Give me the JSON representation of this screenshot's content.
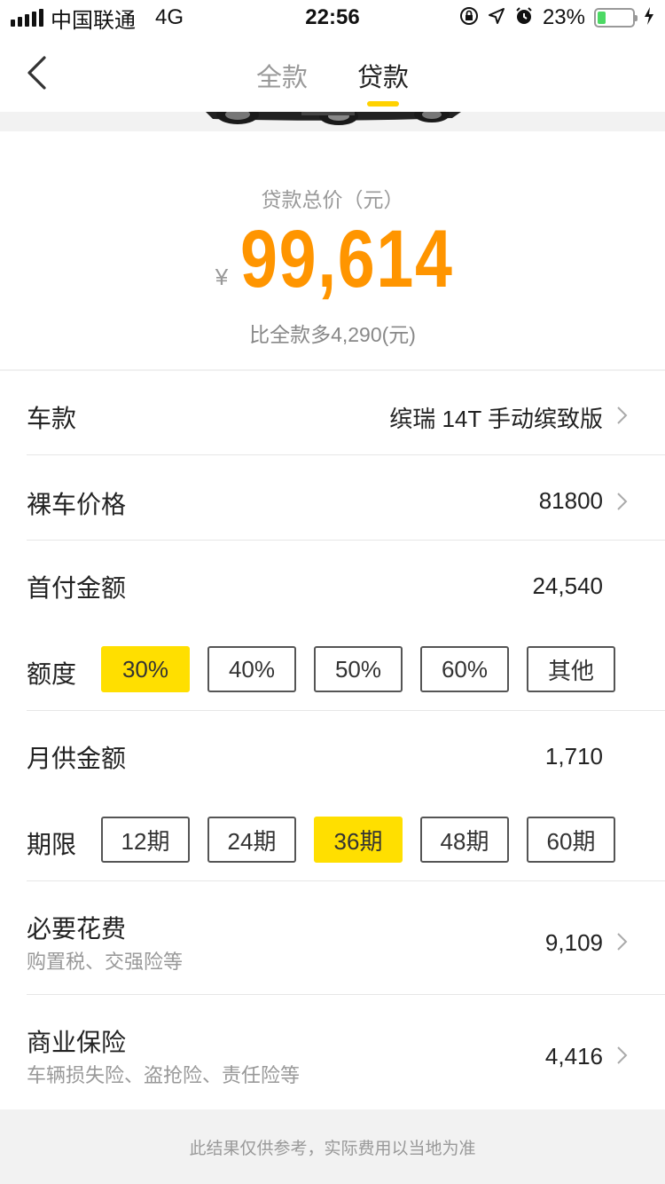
{
  "status_bar": {
    "carrier": "中国联通",
    "network": "4G",
    "time": "22:56",
    "battery": "23%",
    "battery_level": 0.23
  },
  "nav": {
    "tabs": [
      {
        "label": "全款",
        "active": false
      },
      {
        "label": "贷款",
        "active": true
      }
    ]
  },
  "summary": {
    "label": "贷款总价（元）",
    "currency": "¥",
    "total": "99,614",
    "diff_text": "比全款多4,290(元)"
  },
  "rows": {
    "model": {
      "label": "车款",
      "value": "缤瑞 14T 手动缤致版"
    },
    "price": {
      "label": "裸车价格",
      "value": "81800"
    },
    "down_payment": {
      "label": "首付金额",
      "value": "24,540"
    },
    "ratio": {
      "label": "额度",
      "options": [
        "30%",
        "40%",
        "50%",
        "60%",
        "其他"
      ],
      "selected": "30%"
    },
    "monthly": {
      "label": "月供金额",
      "value": "1,710"
    },
    "term": {
      "label": "期限",
      "options": [
        "12期",
        "24期",
        "36期",
        "48期",
        "60期"
      ],
      "selected": "36期"
    },
    "necessary": {
      "label": "必要花费",
      "sub": "购置税、交强险等",
      "value": "9,109"
    },
    "insurance": {
      "label": "商业保险",
      "sub": "车辆损失险、盗抢险、责任险等",
      "value": "4,416"
    }
  },
  "footer": {
    "note": "此结果仅供参考，实际费用以当地为准"
  },
  "colors": {
    "accent_yellow": "#ffdf00",
    "price_orange": "#ff9500",
    "battery_green": "#4cd964"
  }
}
